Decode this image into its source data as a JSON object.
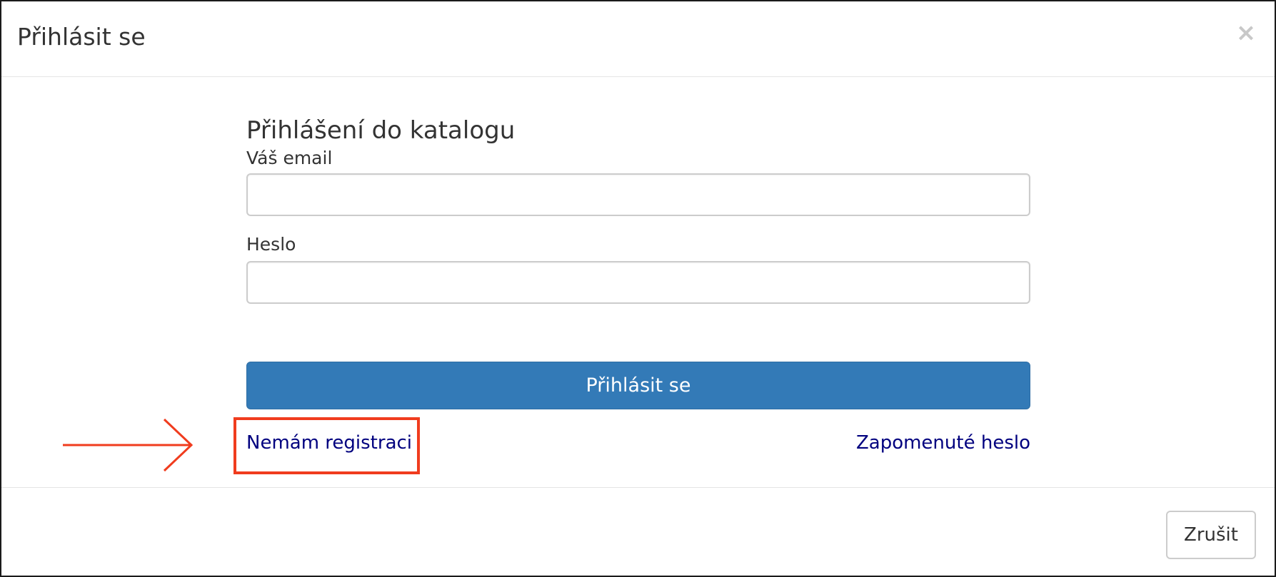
{
  "dialog": {
    "title": "Přihlásit se",
    "close_symbol": "×"
  },
  "form": {
    "heading": "Přihlášení do katalogu",
    "email_label": "Váš email",
    "email_value": "",
    "password_label": "Heslo",
    "password_value": "",
    "submit_label": "Přihlásit se",
    "register_link": "Nemám registraci",
    "forgot_link": "Zapomenuté heslo"
  },
  "footer": {
    "cancel_label": "Zrušit"
  },
  "annotation": {
    "color": "#f03c1e",
    "arrow_icon": "right-arrow-icon"
  },
  "colors": {
    "primary_button": "#337ab7",
    "link": "#00007f"
  }
}
